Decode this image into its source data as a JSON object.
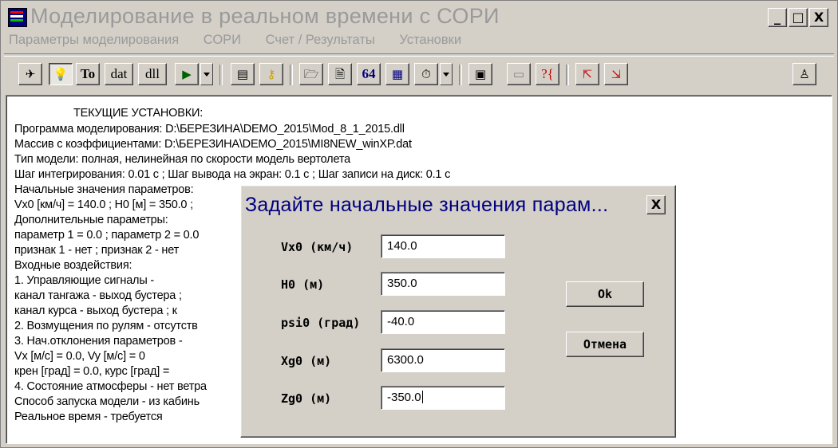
{
  "window": {
    "title": "Моделирование в реальном времени с СОРИ",
    "controls": {
      "minimize": "_",
      "maximize": "□",
      "close": "X"
    }
  },
  "menu": [
    "Параметры моделирования",
    "СОРИ",
    "Счет / Результаты",
    "Установки"
  ],
  "toolbar": {
    "buttons": [
      {
        "name": "plane-icon",
        "glyph": "✈"
      },
      {
        "name": "lightbulb-icon",
        "glyph": "💡"
      },
      {
        "name": "to-icon",
        "label": "To"
      },
      {
        "name": "dat-icon",
        "label": "dat"
      },
      {
        "name": "dll-icon",
        "label": "dll"
      },
      {
        "name": "play-icon",
        "glyph": "▶"
      },
      {
        "name": "notes-icon",
        "glyph": "▤"
      },
      {
        "name": "key-icon",
        "glyph": "⚷"
      },
      {
        "name": "folder-icon",
        "glyph": "🗁"
      },
      {
        "name": "document-icon",
        "glyph": "🗎"
      },
      {
        "name": "b4-icon",
        "label": "64"
      },
      {
        "name": "monitor-icon",
        "glyph": "▦"
      },
      {
        "name": "stopwatch-icon",
        "glyph": "⏱"
      },
      {
        "name": "calculator-icon",
        "glyph": "▣"
      },
      {
        "name": "floppy-icon",
        "glyph": "▭"
      },
      {
        "name": "help-icon",
        "label": "?{"
      },
      {
        "name": "export-icon",
        "glyph": "⇱"
      },
      {
        "name": "exit-icon",
        "glyph": "⇲"
      },
      {
        "name": "person-icon",
        "glyph": "♙"
      }
    ]
  },
  "settings": {
    "heading": "ТЕКУЩИЕ УСТАНОВКИ:",
    "lines": [
      "Программа моделирования:  D:\\БЕРЕЗИНА\\DEMO_2015\\Mod_8_1_2015.dll",
      "Массив с коэффициентами:  D:\\БЕРЕЗИНА\\DEMO_2015\\MI8NEW_winXP.dat",
      "Тип модели:  полная, нелинейная по скорости модель вертолета",
      "Шаг интегрирования:  0.01 с ;   Шаг вывода на экран:  0.1 с ;   Шаг записи на диск:  0.1 с",
      "Начальные значения параметров:",
      "Vx0 [км/ч] = 140.0 ;   H0 [м] = 350.0 ;",
      "Дополнительные параметры:",
      "параметр 1 = 0.0 ;  параметр 2 = 0.0",
      "признак 1 -  нет  ;  признак 2 -  нет",
      "Входные воздействия:",
      "1. Управляющие сигналы -",
      "      канал тангажа - выход бустера ;",
      "      канал курса - выход бустера ;  к",
      "2. Возмущения по рулям  -  отсутств",
      "3. Нач.отклонения параметров -",
      "    Vx    [м/с] = 0.0,   Vy    [м/с] = 0",
      "      крен  [град] = 0.0,    курс  [град] =",
      "4. Состояние атмосферы -  нет ветра",
      "Способ запуска модели -  из кабинь",
      "Реальное время -  требуется"
    ]
  },
  "dialog": {
    "title": "Задайте начальные значения парам...",
    "close": "X",
    "fields": [
      {
        "label": "Vx0  (км/ч)",
        "value": "140.0"
      },
      {
        "label": "H0   (м)",
        "value": "350.0"
      },
      {
        "label": "psi0 (град)",
        "value": "-40.0"
      },
      {
        "label": "Xg0  (м)",
        "value": "6300.0"
      },
      {
        "label": "Zg0  (м)",
        "value": "-350.0"
      }
    ],
    "ok": "Ok",
    "cancel": "Отмена"
  }
}
